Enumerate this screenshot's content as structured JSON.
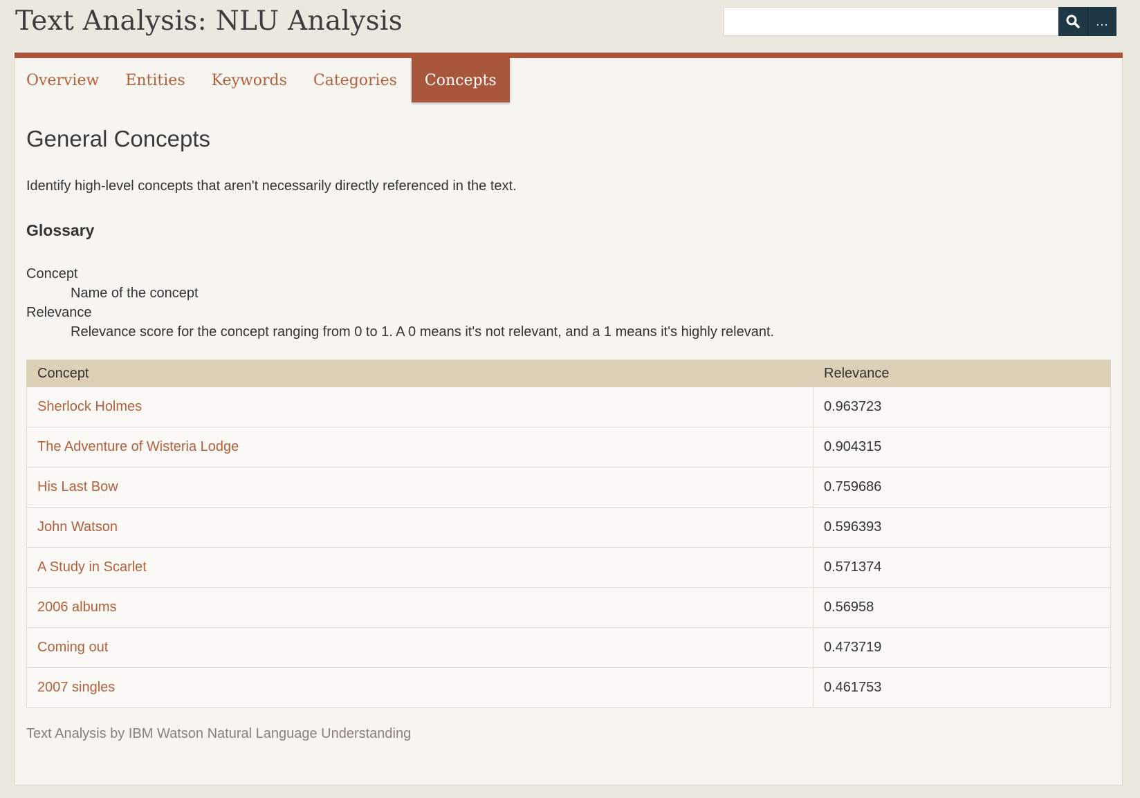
{
  "header": {
    "title": "Text Analysis: NLU Analysis",
    "search_value": "",
    "search_icon": "search-icon",
    "more_label": "..."
  },
  "tabs": [
    {
      "label": "Overview",
      "active": false
    },
    {
      "label": "Entities",
      "active": false
    },
    {
      "label": "Keywords",
      "active": false
    },
    {
      "label": "Categories",
      "active": false
    },
    {
      "label": "Concepts",
      "active": true
    }
  ],
  "section": {
    "title": "General Concepts",
    "description": "Identify high-level concepts that aren't necessarily directly referenced in the text."
  },
  "glossary": {
    "title": "Glossary",
    "items": [
      {
        "term": "Concept",
        "definition": "Name of the concept"
      },
      {
        "term": "Relevance",
        "definition": "Relevance score for the concept ranging from 0 to 1. A 0 means it's not relevant, and a 1 means it's highly relevant."
      }
    ]
  },
  "table": {
    "columns": [
      "Concept",
      "Relevance"
    ],
    "rows": [
      {
        "concept": "Sherlock Holmes",
        "relevance": "0.963723"
      },
      {
        "concept": "The Adventure of Wisteria Lodge",
        "relevance": "0.904315"
      },
      {
        "concept": "His Last Bow",
        "relevance": "0.759686"
      },
      {
        "concept": "John Watson",
        "relevance": "0.596393"
      },
      {
        "concept": "A Study in Scarlet",
        "relevance": "0.571374"
      },
      {
        "concept": "2006 albums",
        "relevance": "0.56958"
      },
      {
        "concept": "Coming out",
        "relevance": "0.473719"
      },
      {
        "concept": "2007 singles",
        "relevance": "0.461753"
      }
    ]
  },
  "footer": {
    "text": "Text Analysis by IBM Watson Natural Language Understanding"
  },
  "colors": {
    "accent": "#a9573c",
    "link": "#b35f3b",
    "search_button": "#1e3845",
    "table_header": "#dcd0b6",
    "background": "#ebe8df"
  }
}
